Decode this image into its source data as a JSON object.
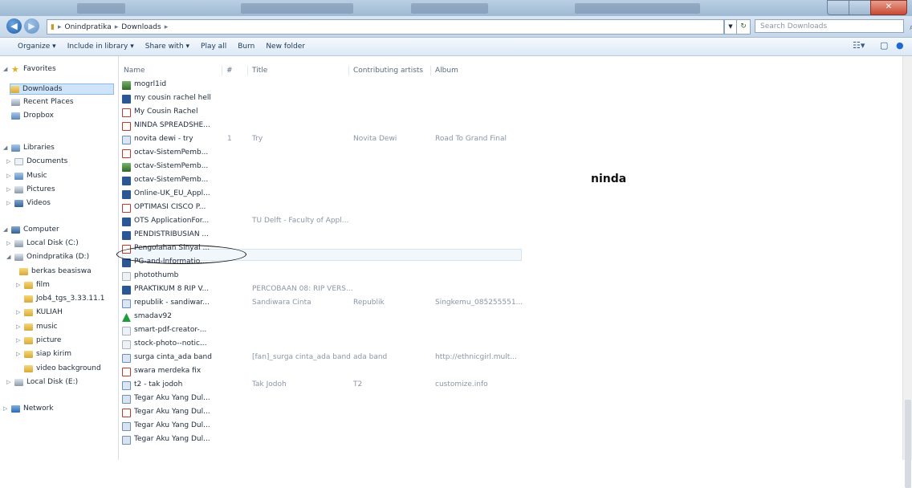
{
  "address": {
    "crumbs": [
      "Onindpratika",
      "Downloads"
    ],
    "search_placeholder": "Search Downloads"
  },
  "toolbar": {
    "organize": "Organize ▾",
    "include": "Include in library ▾",
    "share": "Share with ▾",
    "playall": "Play all",
    "burn": "Burn",
    "newfolder": "New folder"
  },
  "nav": {
    "favorites": "Favorites",
    "downloads": "Downloads",
    "recent": "Recent Places",
    "dropbox": "Dropbox",
    "libraries": "Libraries",
    "documents": "Documents",
    "music": "Music",
    "pictures": "Pictures",
    "videos": "Videos",
    "computer": "Computer",
    "localc": "Local Disk (C:)",
    "onind": "Onindpratika (D:)",
    "berkas": "berkas beasiswa",
    "film": "film",
    "job": "Job4_tgs_3.33.11.1",
    "kuliah": "KULIAH",
    "music2": "music",
    "picture": "picture",
    "siap": "siap kirim",
    "videobg": "video background",
    "locale": "Local Disk (E:)",
    "network": "Network"
  },
  "columns": {
    "name": "Name",
    "num": "#",
    "title": "Title",
    "artists": "Contributing artists",
    "album": "Album"
  },
  "files": [
    {
      "name": "mogrl1id",
      "icon": "image-icon",
      "num": "",
      "title": "",
      "artists": "",
      "album": ""
    },
    {
      "name": "my cousin rachel hell",
      "icon": "word-icon",
      "num": "",
      "title": "",
      "artists": "",
      "album": ""
    },
    {
      "name": "My Cousin Rachel",
      "icon": "pdf-icon",
      "num": "",
      "title": "",
      "artists": "",
      "album": ""
    },
    {
      "name": "NINDA SPREADSHE...",
      "icon": "pdf-icon",
      "num": "",
      "title": "",
      "artists": "",
      "album": ""
    },
    {
      "name": "novita dewi - try",
      "icon": "audio-icon",
      "num": "1",
      "title": "Try",
      "artists": "Novita Dewi",
      "album": "Road To Grand Final"
    },
    {
      "name": "octav-SistemPemb...",
      "icon": "pdf-icon",
      "num": "",
      "title": "",
      "artists": "",
      "album": ""
    },
    {
      "name": "octav-SistemPemb...",
      "icon": "image-icon",
      "num": "",
      "title": "",
      "artists": "",
      "album": ""
    },
    {
      "name": "octav-SistemPemb...",
      "icon": "word-icon",
      "num": "",
      "title": "",
      "artists": "",
      "album": ""
    },
    {
      "name": "Online-UK_EU_Appl...",
      "icon": "word-icon",
      "num": "",
      "title": "",
      "artists": "",
      "album": ""
    },
    {
      "name": "OPTIMASI CISCO P...",
      "icon": "pdf-icon",
      "num": "",
      "title": "",
      "artists": "",
      "album": ""
    },
    {
      "name": "OTS ApplicationFor...",
      "icon": "word-icon",
      "num": "",
      "title": "TU Delft - Faculty of Appl...",
      "artists": "",
      "album": ""
    },
    {
      "name": "PENDISTRIBUSIAN ...",
      "icon": "word-icon",
      "num": "",
      "title": "",
      "artists": "",
      "album": ""
    },
    {
      "name": "Pengolahan Sinyal ...",
      "icon": "pdf-icon",
      "num": "",
      "title": "",
      "artists": "",
      "album": ""
    },
    {
      "name": "PG-and-Informatio...",
      "icon": "word-icon",
      "num": "",
      "title": "",
      "artists": "",
      "album": ""
    },
    {
      "name": "photothumb",
      "icon": "generic-icon",
      "num": "",
      "title": "",
      "artists": "",
      "album": ""
    },
    {
      "name": "PRAKTIKUM 8 RIP V...",
      "icon": "word-icon",
      "num": "",
      "title": "PERCOBAAN 08: RIP VERS...",
      "artists": "",
      "album": ""
    },
    {
      "name": "republik - sandiwar...",
      "icon": "audio-icon",
      "num": "",
      "title": "Sandiwara Cinta",
      "artists": "Republik",
      "album": "Singkemu_085255551..."
    },
    {
      "name": "smadav92",
      "icon": "smadav-icon",
      "num": "",
      "title": "",
      "artists": "",
      "album": ""
    },
    {
      "name": "smart-pdf-creator-...",
      "icon": "generic-icon",
      "num": "",
      "title": "",
      "artists": "",
      "album": ""
    },
    {
      "name": "stock-photo--notic...",
      "icon": "generic-icon",
      "num": "",
      "title": "",
      "artists": "",
      "album": ""
    },
    {
      "name": "surga cinta_ada band",
      "icon": "audio-icon",
      "num": "",
      "title": "[fan]_surga cinta_ada band",
      "artists": "ada band",
      "album": "http://ethnicgirl.mult..."
    },
    {
      "name": "swara merdeka fix",
      "icon": "pdf-icon",
      "num": "",
      "title": "",
      "artists": "",
      "album": ""
    },
    {
      "name": "t2 - tak jodoh",
      "icon": "audio-icon",
      "num": "",
      "title": "Tak Jodoh",
      "artists": "T2",
      "album": "customize.info"
    },
    {
      "name": "Tegar Aku Yang Dul...",
      "icon": "wma-icon",
      "num": "",
      "title": "",
      "artists": "",
      "album": ""
    },
    {
      "name": "Tegar Aku Yang Dul...",
      "icon": "pdf-icon",
      "num": "",
      "title": "",
      "artists": "",
      "album": ""
    },
    {
      "name": "Tegar Aku Yang Dul...",
      "icon": "wma-icon",
      "num": "",
      "title": "",
      "artists": "",
      "album": ""
    },
    {
      "name": "Tegar Aku Yang Dul...",
      "icon": "wma-icon",
      "num": "",
      "title": "",
      "artists": "",
      "album": ""
    }
  ],
  "annotation": "ninda"
}
